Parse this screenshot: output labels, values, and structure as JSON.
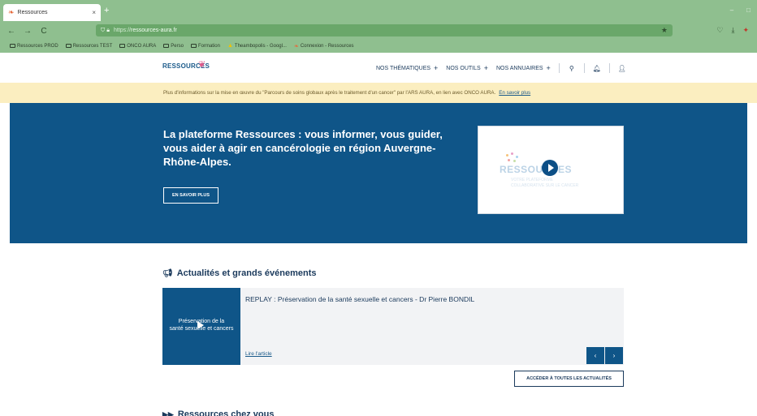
{
  "browser": {
    "tab_title": "Ressources",
    "tab_close": "×",
    "new_tab": "+",
    "window_controls": [
      "–",
      "□"
    ],
    "nav_buttons": [
      "←",
      "→",
      "C"
    ],
    "url_prefix": "https://",
    "url_host": "ressources-aura.fr",
    "bookmarks": [
      "Ressources PROD",
      "Ressources TEST",
      "ONCO AURA",
      "Perso",
      "Formation",
      "Theambopolis - Googl...",
      "Connexion - Ressources"
    ],
    "colors": {
      "chrome": "#8fbf8f",
      "urlbar": "#6aa76a"
    }
  },
  "header": {
    "logo": "RESSOURCES",
    "nav": [
      {
        "label": "NOS THÉMATIQUES",
        "plus": "+"
      },
      {
        "label": "NOS OUTILS",
        "plus": "+"
      },
      {
        "label": "NOS ANNUAIRES",
        "plus": "+"
      }
    ],
    "icons": [
      "search-icon",
      "bell-icon",
      "user-icon"
    ]
  },
  "banner": {
    "text": "Plus d'informations sur la mise en œuvre du \"Parcours de soins globaux après le traitement d'un cancer\" par l'ARS AURA, en lien avec ONCO AURA.",
    "link": "En savoir plus",
    "color": "#fbeec0"
  },
  "hero": {
    "title": "La plateforme Ressources : vous informer, vous guider, vous aider à agir en cancérologie en région Auvergne-Rhône-Alpes.",
    "button": "EN SAVOIR PLUS",
    "color": "#0f5588",
    "video": {
      "brand": "RESSOURCES",
      "sub1": "VOTRE PLATEFORME",
      "sub2": "COLLABORATIVE SUR LE CANCER"
    }
  },
  "news": {
    "section_title": "Actualités et grands événements",
    "card": {
      "thumb_line1": "Préservation de la",
      "thumb_line2": "santé sexuelle et cancers",
      "title": "REPLAY : Préservation de la santé sexuelle et cancers - Dr Pierre BONDIL",
      "link": "Lire l'article"
    },
    "prev": "‹",
    "next": "›",
    "all_button": "ACCÉDER À TOUTES LES ACTUALITÉS"
  },
  "next_section": {
    "title": "Ressources chez vous"
  }
}
